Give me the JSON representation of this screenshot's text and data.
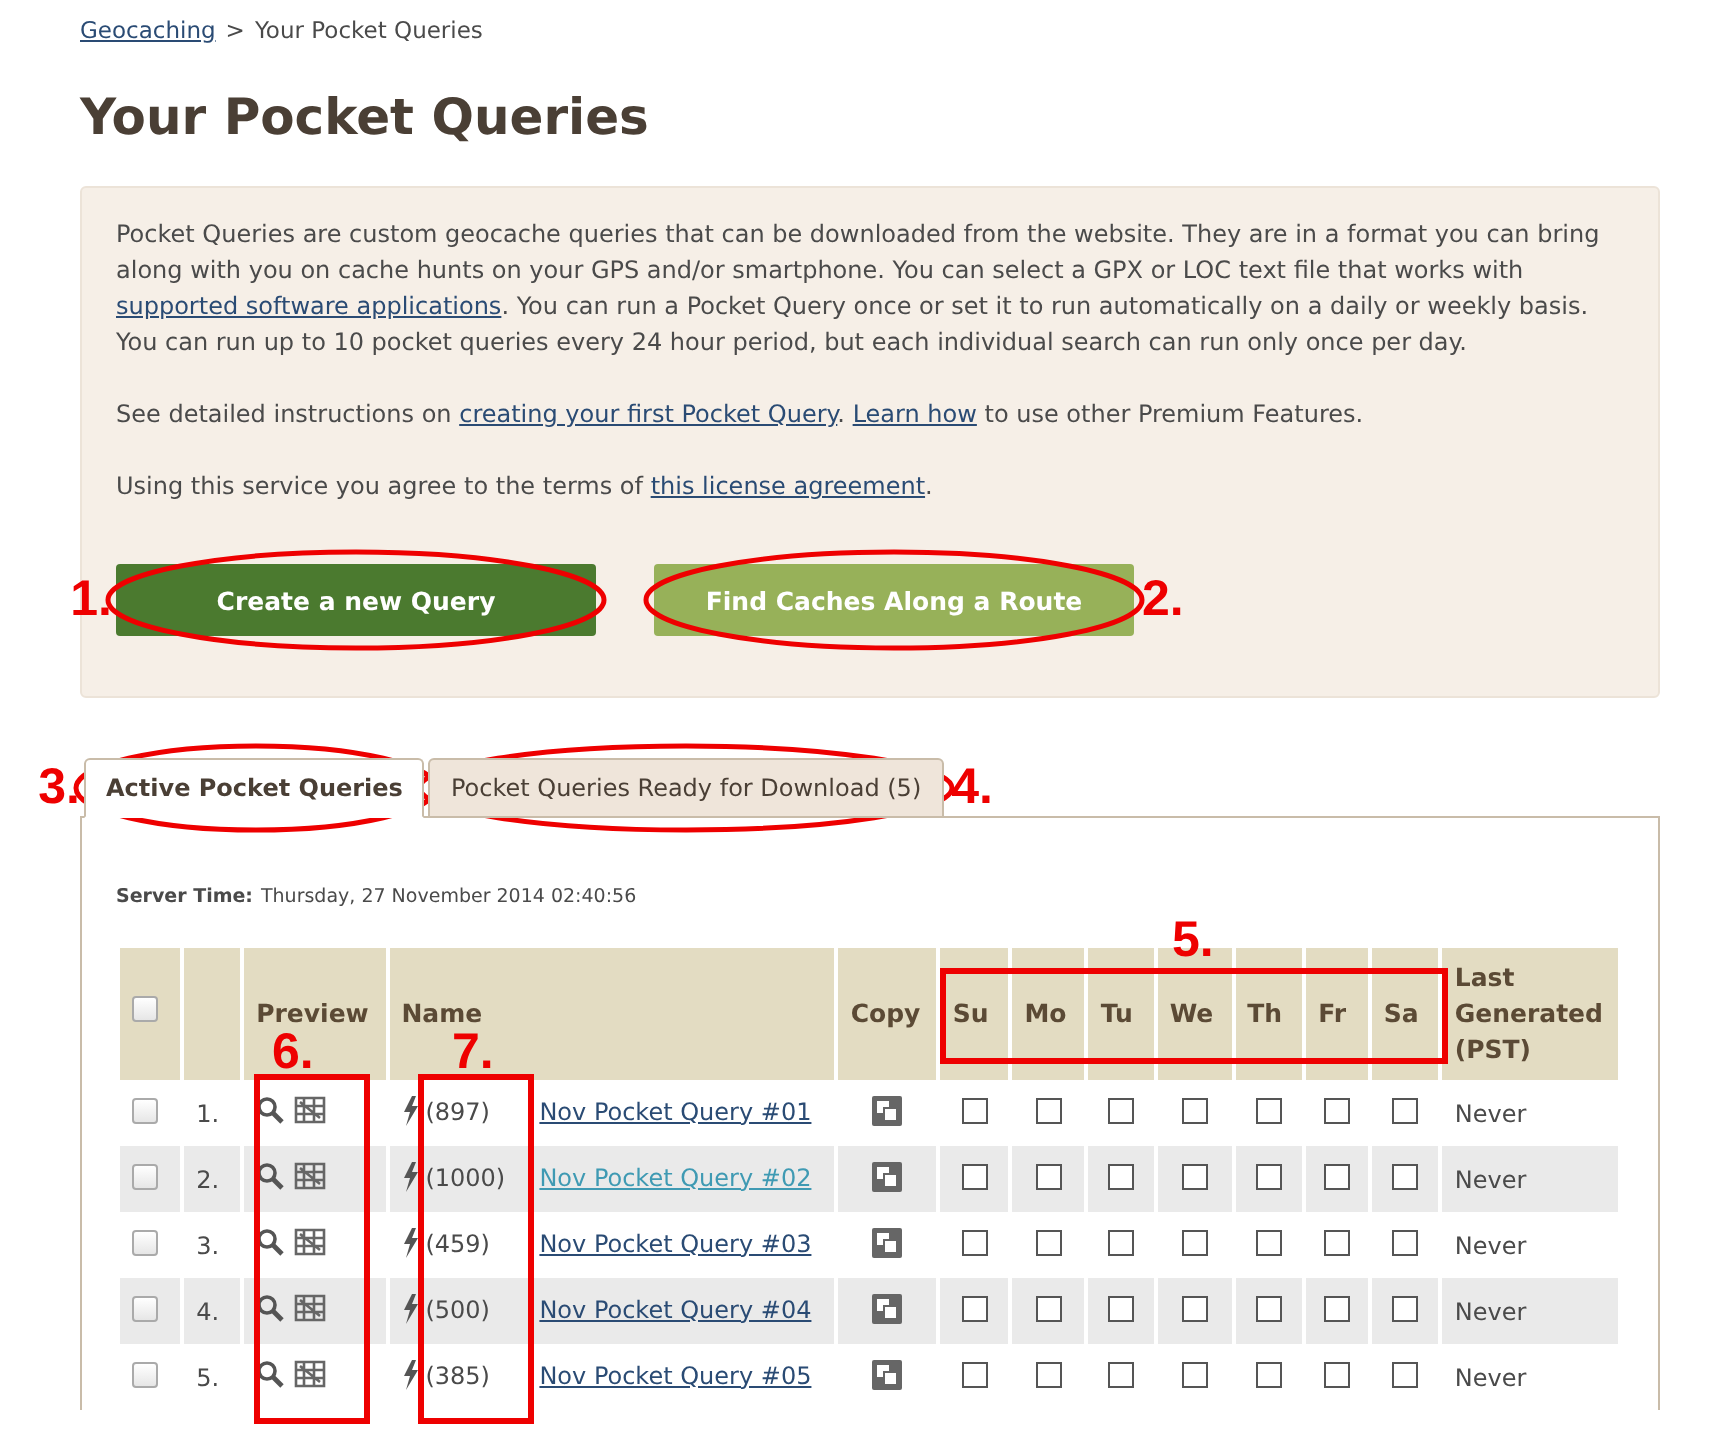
{
  "breadcrumb": {
    "link": "Geocaching",
    "separator": ">",
    "current": "Your Pocket Queries"
  },
  "title": "Your Pocket Queries",
  "intro": {
    "paragraphs": [
      [
        {
          "kind": "text",
          "text": "Pocket Queries are custom geocache queries that can be downloaded from the website. They are in a format you can bring along with you on cache hunts on your GPS and/or smartphone. You can select a GPX or LOC text file that works with "
        },
        {
          "kind": "link",
          "text": "supported software applications"
        },
        {
          "kind": "text",
          "text": ". You can run a Pocket Query once or set it to run automatically on a daily or weekly basis. You can run up to 10 pocket queries every 24 hour period, but each individual search can run only once per day."
        }
      ],
      [
        {
          "kind": "text",
          "text": "See detailed instructions on "
        },
        {
          "kind": "link",
          "text": "creating your first Pocket Query"
        },
        {
          "kind": "text",
          "text": ". "
        },
        {
          "kind": "link",
          "text": "Learn how"
        },
        {
          "kind": "text",
          "text": " to use other Premium Features."
        }
      ],
      [
        {
          "kind": "text",
          "text": "Using this service you agree to the terms of "
        },
        {
          "kind": "link",
          "text": "this license agreement"
        },
        {
          "kind": "text",
          "text": "."
        }
      ]
    ],
    "buttons": [
      {
        "label": "Create a new Query",
        "kind": "primary",
        "annotation_before": "1."
      },
      {
        "label": "Find Caches Along a Route",
        "kind": "secondary",
        "annotation_after": "2."
      }
    ]
  },
  "tabs": [
    {
      "label": "Active Pocket Queries",
      "selected": true,
      "annotation_before": "3."
    },
    {
      "label": "Pocket Queries Ready for Download (5)",
      "selected": false,
      "annotation_after": "4."
    }
  ],
  "server_time": {
    "label": "Server Time:",
    "value": "Thursday, 27 November 2014 02:40:56"
  },
  "table": {
    "select_all": {
      "checked": false
    },
    "columns": {
      "preview": "Preview",
      "name": "Name",
      "copy": "Copy",
      "days": [
        "Su",
        "Mo",
        "Tu",
        "We",
        "Th",
        "Fr",
        "Sa"
      ],
      "last": "Last Generated (PST)"
    },
    "annotations": {
      "days": "5.",
      "preview": "6.",
      "count": "7."
    },
    "rows": [
      {
        "number": "1.",
        "count": "(897)",
        "name": "Nov Pocket Query #01",
        "hovered": false,
        "checked": false,
        "days": [
          false,
          false,
          false,
          false,
          false,
          false,
          false
        ],
        "last": "Never"
      },
      {
        "number": "2.",
        "count": "(1000)",
        "name": "Nov Pocket Query #02",
        "hovered": true,
        "checked": false,
        "days": [
          false,
          false,
          false,
          false,
          false,
          false,
          false
        ],
        "last": "Never"
      },
      {
        "number": "3.",
        "count": "(459)",
        "name": "Nov Pocket Query #03",
        "hovered": false,
        "checked": false,
        "days": [
          false,
          false,
          false,
          false,
          false,
          false,
          false
        ],
        "last": "Never"
      },
      {
        "number": "4.",
        "count": "(500)",
        "name": "Nov Pocket Query #04",
        "hovered": false,
        "checked": false,
        "days": [
          false,
          false,
          false,
          false,
          false,
          false,
          false
        ],
        "last": "Never"
      },
      {
        "number": "5.",
        "count": "(385)",
        "name": "Nov Pocket Query #05",
        "hovered": false,
        "checked": false,
        "days": [
          false,
          false,
          false,
          false,
          false,
          false,
          false
        ],
        "last": "Never"
      }
    ]
  }
}
